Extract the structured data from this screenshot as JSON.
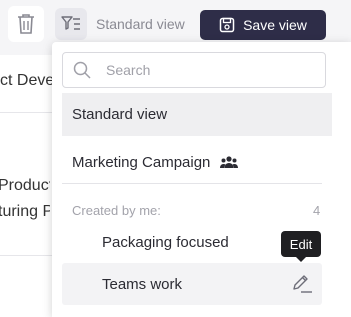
{
  "toolbar": {
    "current_view": "Standard view",
    "save_label": "Save view"
  },
  "background": {
    "project_partial": "ct Develo",
    "product_partial": "Product",
    "manufacturing_partial": "turing P"
  },
  "dropdown": {
    "search_placeholder": "Search",
    "standard_view": "Standard view",
    "marketing_campaign": "Marketing Campaign",
    "section_label": "Created by me:",
    "section_count": "4",
    "items": [
      "Packaging focused",
      "Teams work"
    ],
    "tooltip": "Edit"
  },
  "colors": {
    "save_button_bg": "#2e2d48",
    "selected_row_bg": "#efeff1",
    "tooltip_bg": "#1f1f22"
  }
}
